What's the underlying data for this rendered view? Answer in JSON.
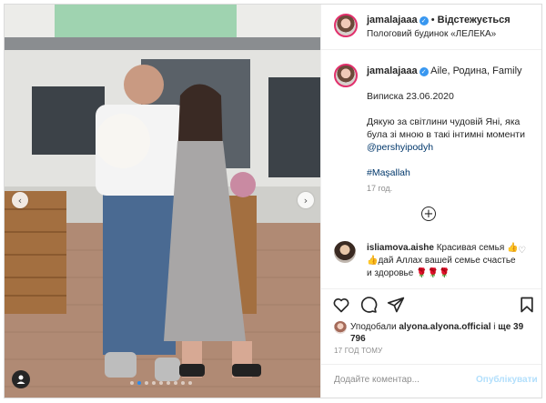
{
  "header": {
    "username": "jamalajaaa",
    "separator": "•",
    "follow_state": "Відстежується",
    "location": "Пологовий будинок «ЛЕЛЕКА»"
  },
  "caption": {
    "username": "jamalajaaa",
    "first_line": "Aile, Родина, Family",
    "paragraph_1": "Виписка 23.06.2020",
    "paragraph_2": "Дякую за світлини чудовій Яні, яка була зі мною в такі інтимні моменти",
    "mention": "@pershyipodyh",
    "hashtag": "#Maşallah",
    "time": "17 год."
  },
  "comment": {
    "username": "isliamova.aishe",
    "text": "Красивая семья 👍👍дай Аллах вашей семье счастье и здоровье 🌹🌹🌹"
  },
  "likes": {
    "prefix": "Уподобали",
    "user": "alyona.alyona.official",
    "middle": "і",
    "count_text": "ще 39 796"
  },
  "post_time": "17 ГОД ТОМУ",
  "add_comment": {
    "placeholder": "Додайте коментар...",
    "post_label": "Опублікувати"
  },
  "carousel": {
    "slide_count": 9,
    "active_index": 1
  },
  "icons": {
    "verified": "verified-badge-icon",
    "add": "plus-circle-icon",
    "like": "heart-icon",
    "comment": "speech-bubble-icon",
    "share": "paper-plane-icon",
    "save": "bookmark-icon",
    "tag": "user-tag-icon",
    "prev": "chevron-left-icon",
    "next": "chevron-right-icon"
  },
  "colors": {
    "accent_blue": "#3897f0",
    "link": "#00376b",
    "muted": "#8e8e8e",
    "post_button_disabled": "#b2dffc"
  }
}
